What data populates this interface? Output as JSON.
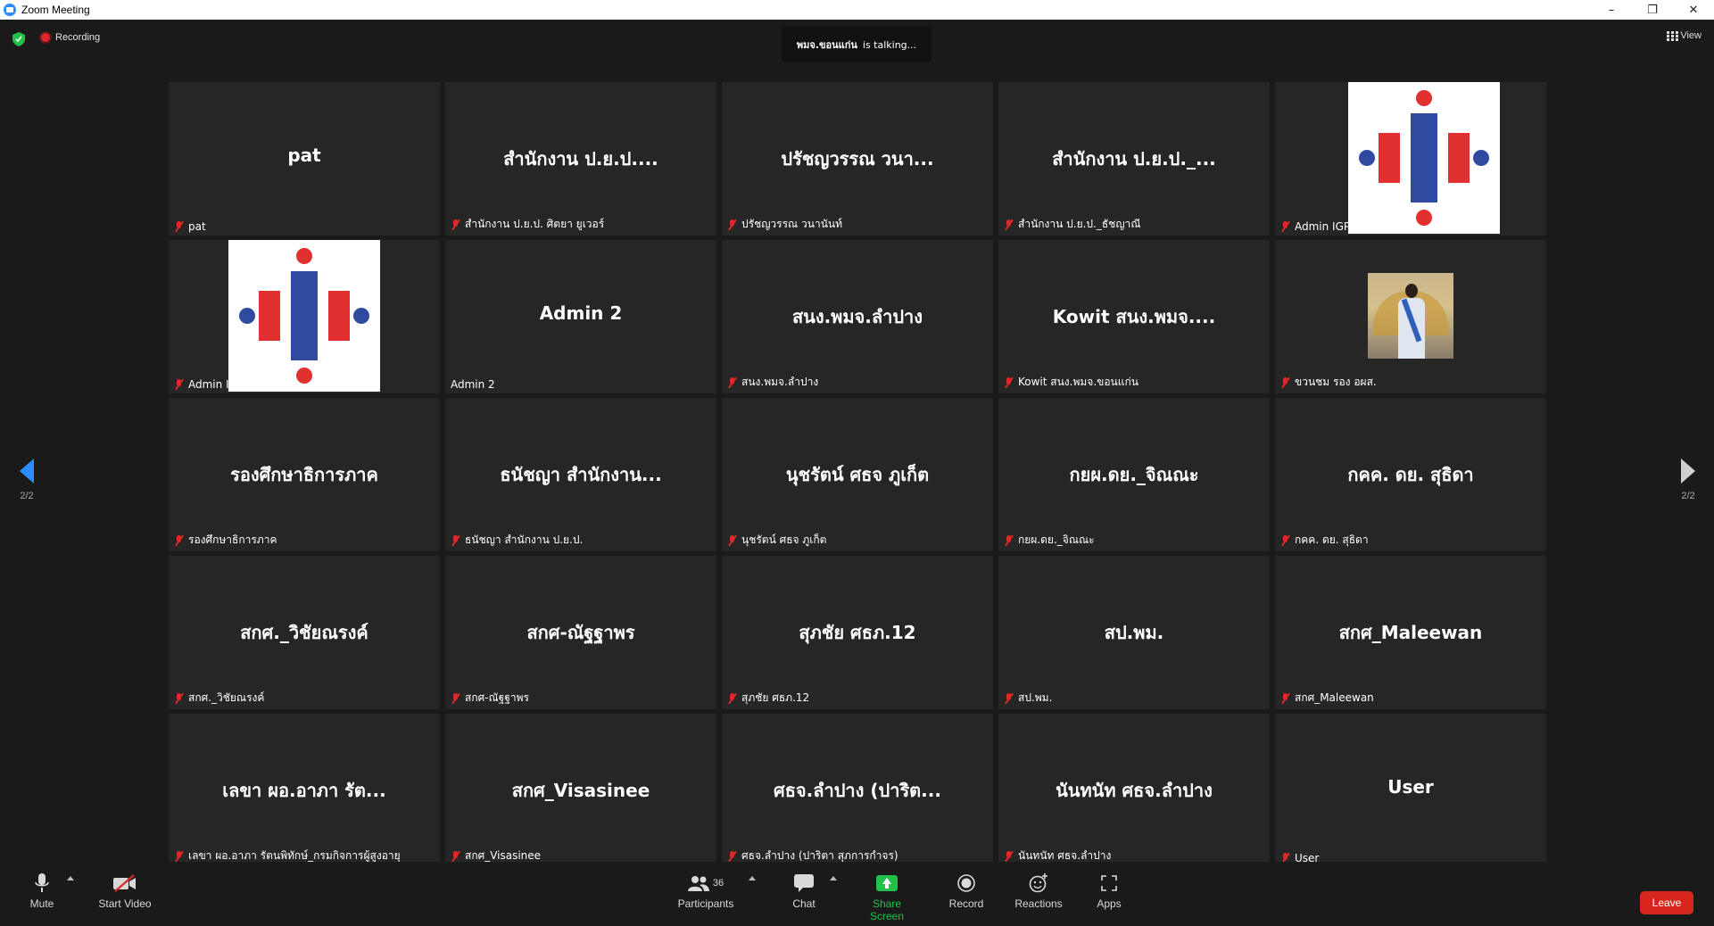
{
  "window": {
    "title": "Zoom Meeting",
    "minimize": "–",
    "restore": "❐",
    "close": "✕"
  },
  "top": {
    "recording_label": "Recording",
    "talking_name": "พมจ.ขอนแก่น",
    "talking_suffix": "is talking...",
    "view_label": "View"
  },
  "nav": {
    "left_page": "2/2",
    "right_page": "2/2"
  },
  "tiles": [
    {
      "big": "pat",
      "name": "pat",
      "muted": true,
      "kind": "text"
    },
    {
      "big": "สำนักงาน ป.ย.ป....",
      "name": "สำนักงาน ป.ย.ป. ศิตยา ยูเวอร์",
      "muted": true,
      "kind": "text"
    },
    {
      "big": "ปรัชญวรรณ วนา...",
      "name": "ปรัชญวรรณ วนานันท์",
      "muted": true,
      "kind": "text"
    },
    {
      "big": "สำนักงาน ป.ย.ป._...",
      "name": "สำนักงาน ป.ย.ป._ธัชญาณี",
      "muted": true,
      "kind": "text"
    },
    {
      "big": "",
      "name": "Admin IGP Darat",
      "muted": true,
      "kind": "logo"
    },
    {
      "big": "",
      "name": "Admin IGP",
      "muted": true,
      "kind": "logo"
    },
    {
      "big": "Admin 2",
      "name": "Admin 2",
      "muted": false,
      "kind": "text"
    },
    {
      "big": "สนง.พมจ.ลำปาง",
      "name": "สนง.พมจ.ลำปาง",
      "muted": true,
      "kind": "text"
    },
    {
      "big": "Kowit สนง.พมจ....",
      "name": "Kowit สนง.พมจ.ขอนแก่น",
      "muted": true,
      "kind": "text"
    },
    {
      "big": "",
      "name": "ขวนชม รอง อผส.",
      "muted": true,
      "kind": "photo"
    },
    {
      "big": "รองศึกษาธิการภาค",
      "name": "รองศึกษาธิการภาค",
      "muted": true,
      "kind": "text"
    },
    {
      "big": "ธนัชญา สำนักงาน...",
      "name": "ธนัชญา สำนักงาน ป.ย.ป.",
      "muted": true,
      "kind": "text"
    },
    {
      "big": "นุชรัตน์ ศธจ ภูเก็ต",
      "name": "นุชรัตน์ ศธจ ภูเก็ต",
      "muted": true,
      "kind": "text"
    },
    {
      "big": "กยผ.ดย._จิณณะ",
      "name": "กยผ.ดย._จิณณะ",
      "muted": true,
      "kind": "text"
    },
    {
      "big": "กคค. ดย. สุธิดา",
      "name": "กคค. ดย. สุธิดา",
      "muted": true,
      "kind": "text"
    },
    {
      "big": "สกศ._วิชัยณรงค์",
      "name": "สกศ._วิชัยณรงค์",
      "muted": true,
      "kind": "text"
    },
    {
      "big": "สกศ-ณัฐฐาพร",
      "name": "สกศ-ณัฐฐาพร",
      "muted": true,
      "kind": "text"
    },
    {
      "big": "สุภชัย ศธภ.12",
      "name": "สุภชัย ศธภ.12",
      "muted": true,
      "kind": "text"
    },
    {
      "big": "สป.พม.",
      "name": "สป.พม.",
      "muted": true,
      "kind": "text"
    },
    {
      "big": "สกศ_Maleewan",
      "name": "สกศ_Maleewan",
      "muted": true,
      "kind": "text"
    },
    {
      "big": "เลขา ผอ.อาภา รัต...",
      "name": "เลขา ผอ.อาภา รัตนพิทักษ์_กรมกิจการผู้สูงอายุ",
      "muted": true,
      "kind": "text"
    },
    {
      "big": "สกศ_Visasinee",
      "name": "สกศ_Visasinee",
      "muted": true,
      "kind": "text"
    },
    {
      "big": "ศธจ.ลำปาง (ปาริต...",
      "name": "ศธจ.ลำปาง (ปาริตา สุภการกำจร)",
      "muted": true,
      "kind": "text"
    },
    {
      "big": "นันทนัท ศธจ.ลำปาง",
      "name": "นันทนัท ศธจ.ลำปาง",
      "muted": true,
      "kind": "text"
    },
    {
      "big": "User",
      "name": "User",
      "muted": true,
      "kind": "text"
    }
  ],
  "toolbar": {
    "mute": "Mute",
    "start_video": "Start Video",
    "participants": "Participants",
    "participants_count": "36",
    "chat": "Chat",
    "share_screen": "Share Screen",
    "record": "Record",
    "reactions": "Reactions",
    "apps": "Apps",
    "leave": "Leave"
  },
  "colors": {
    "accent": "#2d8cff",
    "leave": "#d7261e",
    "share": "#23c14a",
    "muted": "#e02828"
  }
}
